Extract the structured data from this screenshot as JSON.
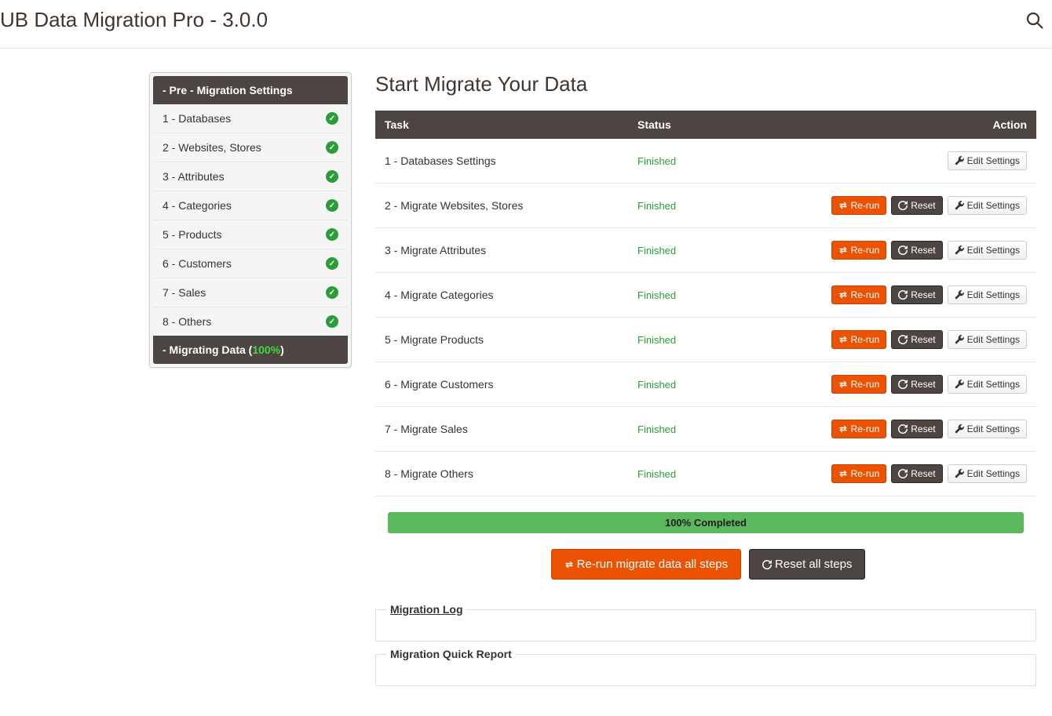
{
  "header": {
    "title": "UB Data Migration Pro - 3.0.0"
  },
  "sidebar": {
    "header": "- Pre - Migration Settings",
    "items": [
      {
        "label": "1 - Databases"
      },
      {
        "label": "2 - Websites, Stores"
      },
      {
        "label": "3 - Attributes"
      },
      {
        "label": "4 - Categories"
      },
      {
        "label": "5 - Products"
      },
      {
        "label": "6 - Customers"
      },
      {
        "label": "7 - Sales"
      },
      {
        "label": "8 - Others"
      }
    ],
    "footer_prefix": "- Migrating Data (",
    "footer_percent": "100%",
    "footer_suffix": ")"
  },
  "main": {
    "heading": "Start Migrate Your Data",
    "columns": {
      "task": "Task",
      "status": "Status",
      "action": "Action"
    },
    "status_label": "Finished",
    "btn_rerun": "Re-run",
    "btn_reset": "Reset",
    "btn_edit": "Edit Settings",
    "tasks": [
      {
        "name": "1 - Databases Settings",
        "rerun": false,
        "reset": false
      },
      {
        "name": "2 - Migrate Websites, Stores",
        "rerun": true,
        "reset": true
      },
      {
        "name": "3 - Migrate Attributes",
        "rerun": true,
        "reset": true
      },
      {
        "name": "4 - Migrate Categories",
        "rerun": true,
        "reset": true
      },
      {
        "name": "5 - Migrate Products",
        "rerun": true,
        "reset": true
      },
      {
        "name": "6 - Migrate Customers",
        "rerun": true,
        "reset": true
      },
      {
        "name": "7 - Migrate Sales",
        "rerun": true,
        "reset": true
      },
      {
        "name": "8 - Migrate Others",
        "rerun": true,
        "reset": true
      }
    ],
    "progress": "100% Completed",
    "btn_rerun_all": "Re-run migrate data all steps",
    "btn_reset_all": "Reset all steps",
    "log_title": "Migration Log",
    "report_title": "Migration Quick Report"
  }
}
